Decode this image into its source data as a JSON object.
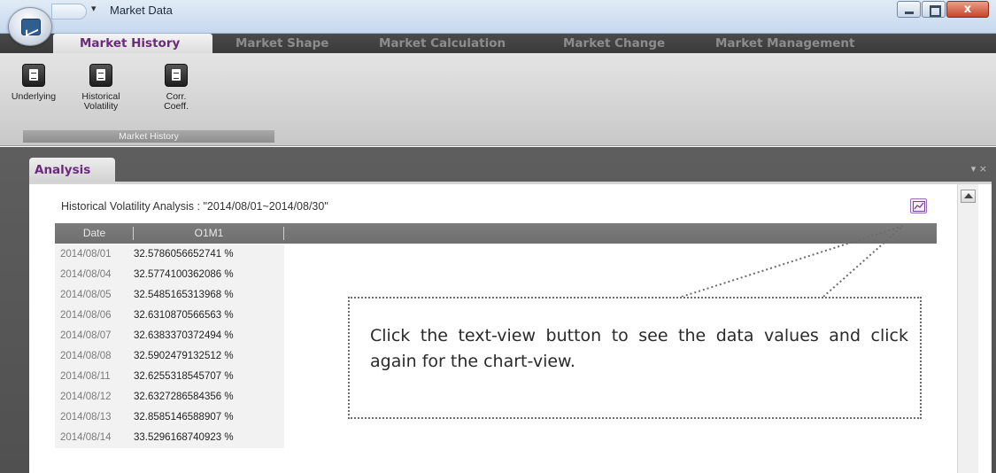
{
  "window": {
    "title": "Market Data",
    "qat_dropdown_glyph": "▾",
    "close_glyph": "x"
  },
  "ribbon": {
    "tabs": [
      {
        "label": "Market History",
        "active": true
      },
      {
        "label": "Market Shape",
        "active": false
      },
      {
        "label": "Market Calculation",
        "active": false
      },
      {
        "label": "Market Change",
        "active": false
      },
      {
        "label": "Market Management",
        "active": false
      }
    ],
    "buttons": [
      {
        "label": "Underlying",
        "icon": "document-icon"
      },
      {
        "label": "Historical\nVolatility",
        "icon": "document-icon"
      },
      {
        "label": "Corr.\nCoeff.",
        "icon": "document-icon"
      }
    ],
    "group_label": "Market History"
  },
  "panel": {
    "tab_label": "Analysis",
    "controls": "▾ ×",
    "title": "Historical Volatility Analysis : \"2014/08/01~2014/08/30\"",
    "view_toggle_icon": "chart-view-icon",
    "accent_color": "#6b2a7c"
  },
  "table": {
    "columns": [
      "Date",
      "O1M1"
    ],
    "rows": [
      {
        "date": "2014/08/01",
        "value": "32.5786056652741 %"
      },
      {
        "date": "2014/08/04",
        "value": "32.5774100362086 %"
      },
      {
        "date": "2014/08/05",
        "value": "32.5485165313968 %"
      },
      {
        "date": "2014/08/06",
        "value": "32.6310870566563 %"
      },
      {
        "date": "2014/08/07",
        "value": "32.6383370372494 %"
      },
      {
        "date": "2014/08/08",
        "value": "32.5902479132512 %"
      },
      {
        "date": "2014/08/11",
        "value": "32.6255318545707 %"
      },
      {
        "date": "2014/08/12",
        "value": "32.6327286584356 %"
      },
      {
        "date": "2014/08/13",
        "value": "32.8585146588907 %"
      },
      {
        "date": "2014/08/14",
        "value": "33.5296168740923 %"
      }
    ]
  },
  "callout": {
    "text": "Click the text-view button to see the data values and click again for the chart-view."
  }
}
